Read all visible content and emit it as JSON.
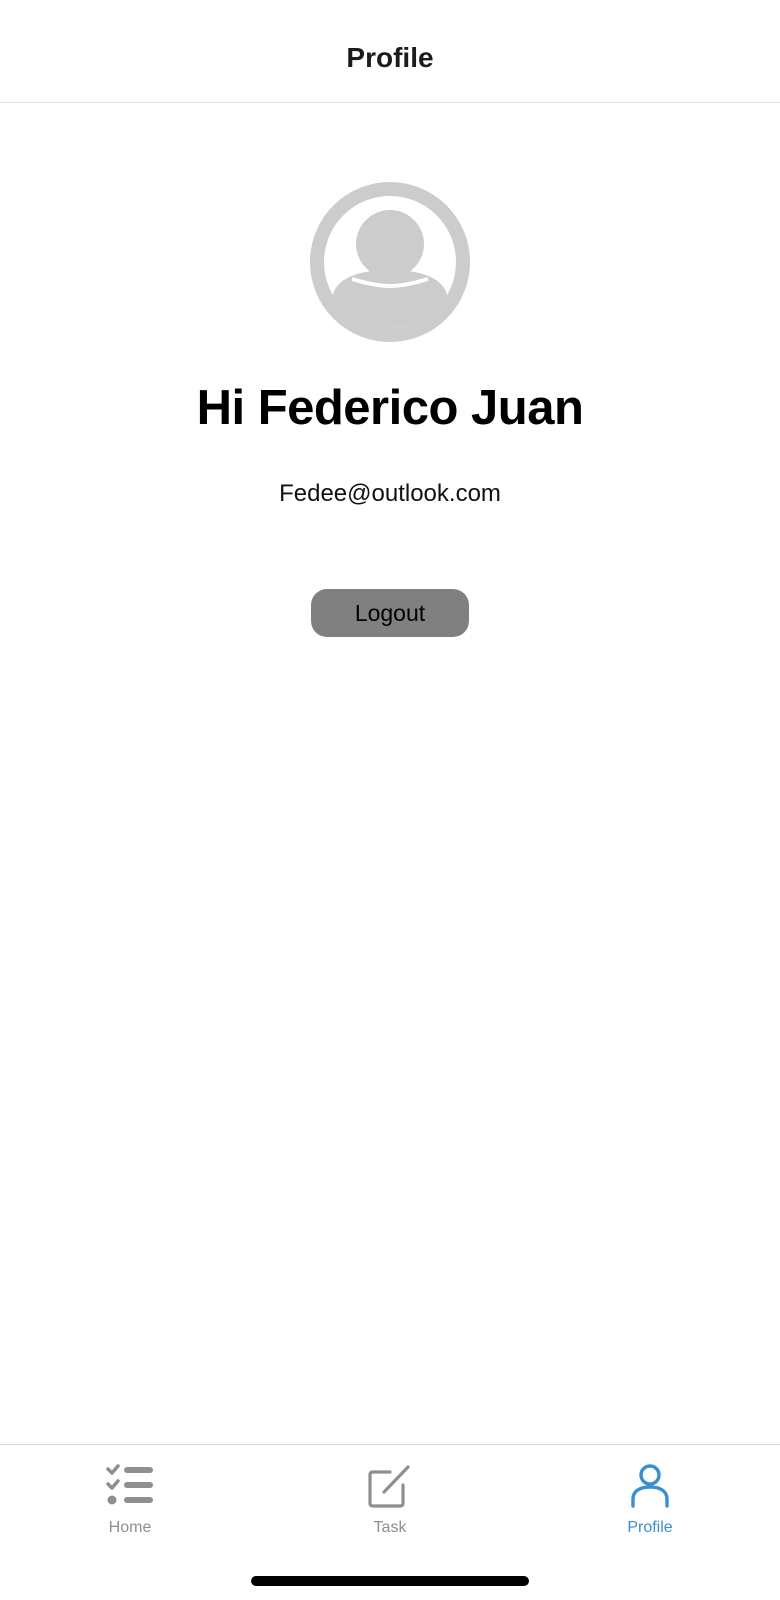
{
  "header": {
    "title": "Profile"
  },
  "profile": {
    "avatar_icon": "user-circle-icon",
    "greeting": "Hi Federico Juan",
    "email": "Fedee@outlook.com",
    "logout_label": "Logout"
  },
  "tab_bar": {
    "items": [
      {
        "label": "Home",
        "icon": "checklist-icon",
        "active": false
      },
      {
        "label": "Task",
        "icon": "edit-square-icon",
        "active": false
      },
      {
        "label": "Profile",
        "icon": "person-icon",
        "active": true
      }
    ]
  },
  "colors": {
    "accent": "#3a8fd0",
    "inactive": "#8e8e93",
    "avatar": "#cccccc",
    "button": "#808080"
  }
}
